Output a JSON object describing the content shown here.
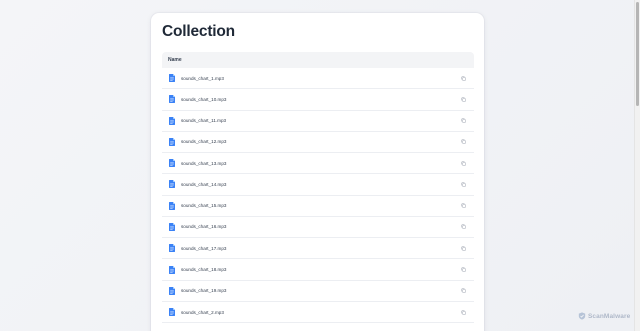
{
  "page": {
    "title": "Collection"
  },
  "table": {
    "header_name": "Name",
    "files": [
      {
        "name": "sounds_chart_1.mp3"
      },
      {
        "name": "sounds_chart_10.mp3"
      },
      {
        "name": "sounds_chart_11.mp3"
      },
      {
        "name": "sounds_chart_12.mp3"
      },
      {
        "name": "sounds_chart_13.mp3"
      },
      {
        "name": "sounds_chart_14.mp3"
      },
      {
        "name": "sounds_chart_15.mp3"
      },
      {
        "name": "sounds_chart_16.mp3"
      },
      {
        "name": "sounds_chart_17.mp3"
      },
      {
        "name": "sounds_chart_18.mp3"
      },
      {
        "name": "sounds_chart_19.mp3"
      },
      {
        "name": "sounds_chart_2.mp3"
      }
    ],
    "row_icon": "file-document-icon",
    "row_action_icon": "copy-icon"
  },
  "watermark": {
    "text": "ScanMalware"
  },
  "colors": {
    "file_icon": "#3b82f6",
    "copy_icon": "#9ca3af",
    "title": "#1f2937"
  }
}
